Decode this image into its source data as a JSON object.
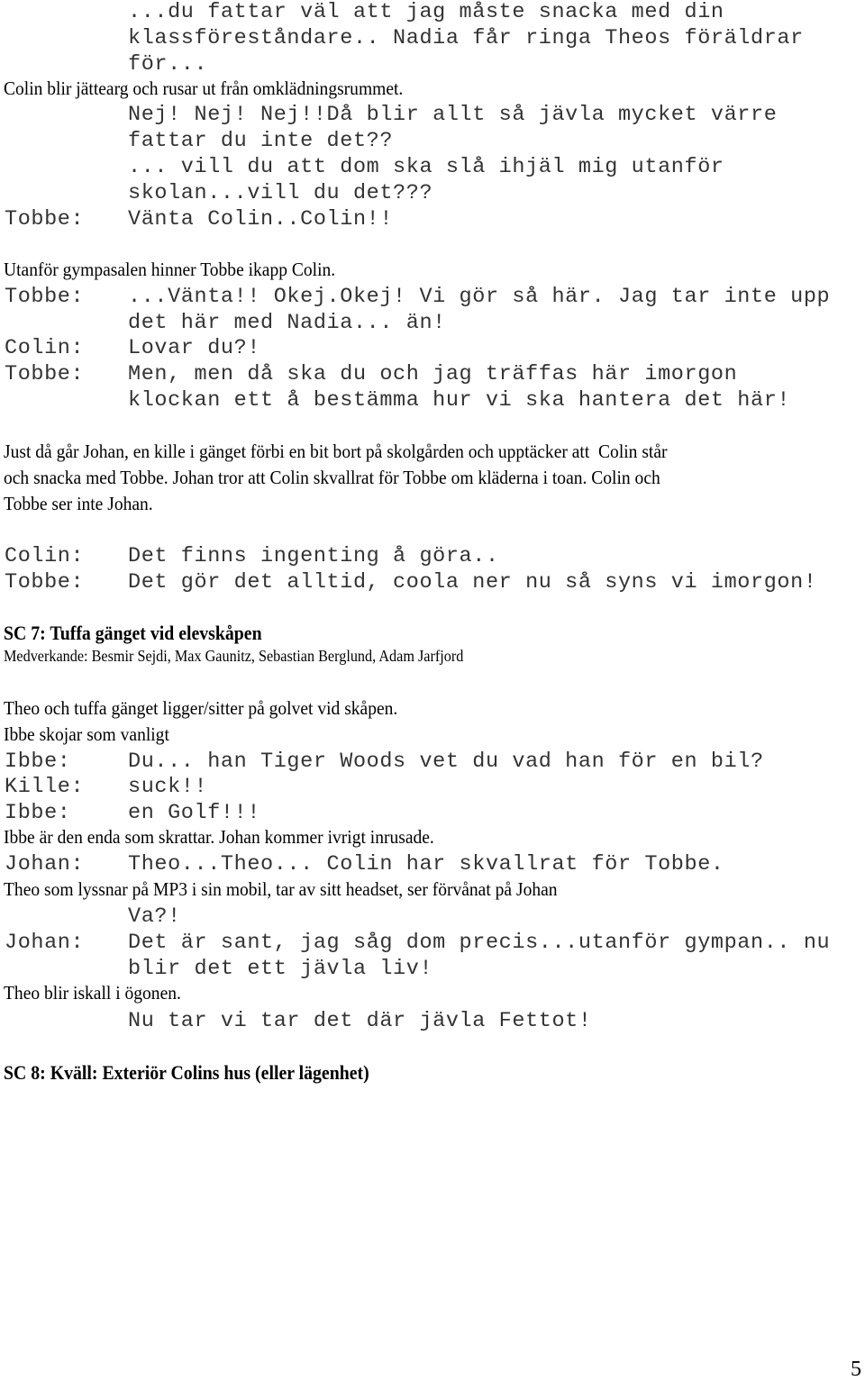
{
  "page_number": "5",
  "blocks": [
    {
      "type": "dialogue",
      "speaker": "",
      "lines": [
        "...du fattar väl att jag måste snacka med din",
        "klassföreståndare.. Nadia får ringa Theos föräldrar",
        "för..."
      ]
    },
    {
      "type": "action",
      "text": "Colin blir jättearg och rusar ut från omklädningsrummet."
    },
    {
      "type": "dialogue",
      "speaker": "",
      "lines": [
        "Nej! Nej! Nej!!Då blir allt så jävla mycket värre",
        "fattar du inte det??",
        "... vill du att dom ska slå ihjäl mig utanför",
        "skolan...vill du det???"
      ]
    },
    {
      "type": "dialogue",
      "speaker": "Tobbe:",
      "lines": [
        "Vänta Colin..Colin!!"
      ]
    },
    {
      "type": "action",
      "text": "Utanför gympasalen hinner Tobbe ikapp Colin."
    },
    {
      "type": "dialogue",
      "speaker": "Tobbe:",
      "lines": [
        "...Vänta!! Okej.Okej! Vi gör så här. Jag tar inte upp",
        "det här med Nadia... än!"
      ]
    },
    {
      "type": "dialogue",
      "speaker": "Colin:",
      "lines": [
        "Lovar du?!"
      ]
    },
    {
      "type": "dialogue",
      "speaker": "Tobbe:",
      "lines": [
        "Men, men då ska du och jag träffas här imorgon",
        "klockan ett å bestämma hur vi ska hantera det här!"
      ]
    },
    {
      "type": "action_multi",
      "lines": [
        "Just då går Johan, en kille i gänget förbi en bit bort på skolgården och upptäcker att  Colin står",
        "och snacka med Tobbe. Johan tror att Colin skvallrat för Tobbe om kläderna i toan. Colin och",
        "Tobbe ser inte Johan."
      ]
    },
    {
      "type": "dialogue",
      "speaker": "Colin:",
      "lines": [
        "Det finns ingenting å göra.."
      ]
    },
    {
      "type": "dialogue",
      "speaker": "Tobbe:",
      "lines": [
        "Det gör det alltid, coola ner nu så syns vi imorgon!"
      ]
    },
    {
      "type": "heading",
      "text": "SC 7: Tuffa gänget vid elevskåpen"
    },
    {
      "type": "cast",
      "text": "Medverkande: Besmir Sejdi, Max Gaunitz, Sebastian Berglund, Adam Jarfjord"
    },
    {
      "type": "action",
      "text": "Theo och tuffa gänget ligger/sitter på golvet vid skåpen."
    },
    {
      "type": "action",
      "text": "Ibbe skojar som vanligt"
    },
    {
      "type": "dialogue",
      "speaker": "Ibbe:",
      "lines": [
        "Du... han Tiger Woods vet du vad han för en bil?"
      ]
    },
    {
      "type": "dialogue",
      "speaker": "Kille:",
      "lines": [
        "suck!!"
      ]
    },
    {
      "type": "dialogue",
      "speaker": "Ibbe:",
      "lines": [
        "en Golf!!!"
      ]
    },
    {
      "type": "action",
      "text": "Ibbe är den enda som skrattar. Johan kommer ivrigt inrusade."
    },
    {
      "type": "dialogue",
      "speaker": "Johan:",
      "lines": [
        "Theo...Theo... Colin har skvallrat för Tobbe."
      ]
    },
    {
      "type": "action",
      "text": "Theo som lyssnar på MP3 i sin mobil, tar av sitt headset, ser förvånat på Johan"
    },
    {
      "type": "dialogue",
      "speaker": "",
      "lines": [
        "Va?!"
      ]
    },
    {
      "type": "dialogue",
      "speaker": "Johan:",
      "lines": [
        "Det är sant, jag såg dom precis...utanför gympan.. nu",
        "blir det ett jävla liv!"
      ]
    },
    {
      "type": "action",
      "text": "Theo blir iskall i ögonen."
    },
    {
      "type": "dialogue",
      "speaker": "",
      "lines": [
        "Nu tar vi tar det där jävla Fettot!"
      ]
    },
    {
      "type": "heading",
      "text": "SC 8: Kväll: Exteriör Colins hus (eller lägenhet)"
    }
  ]
}
